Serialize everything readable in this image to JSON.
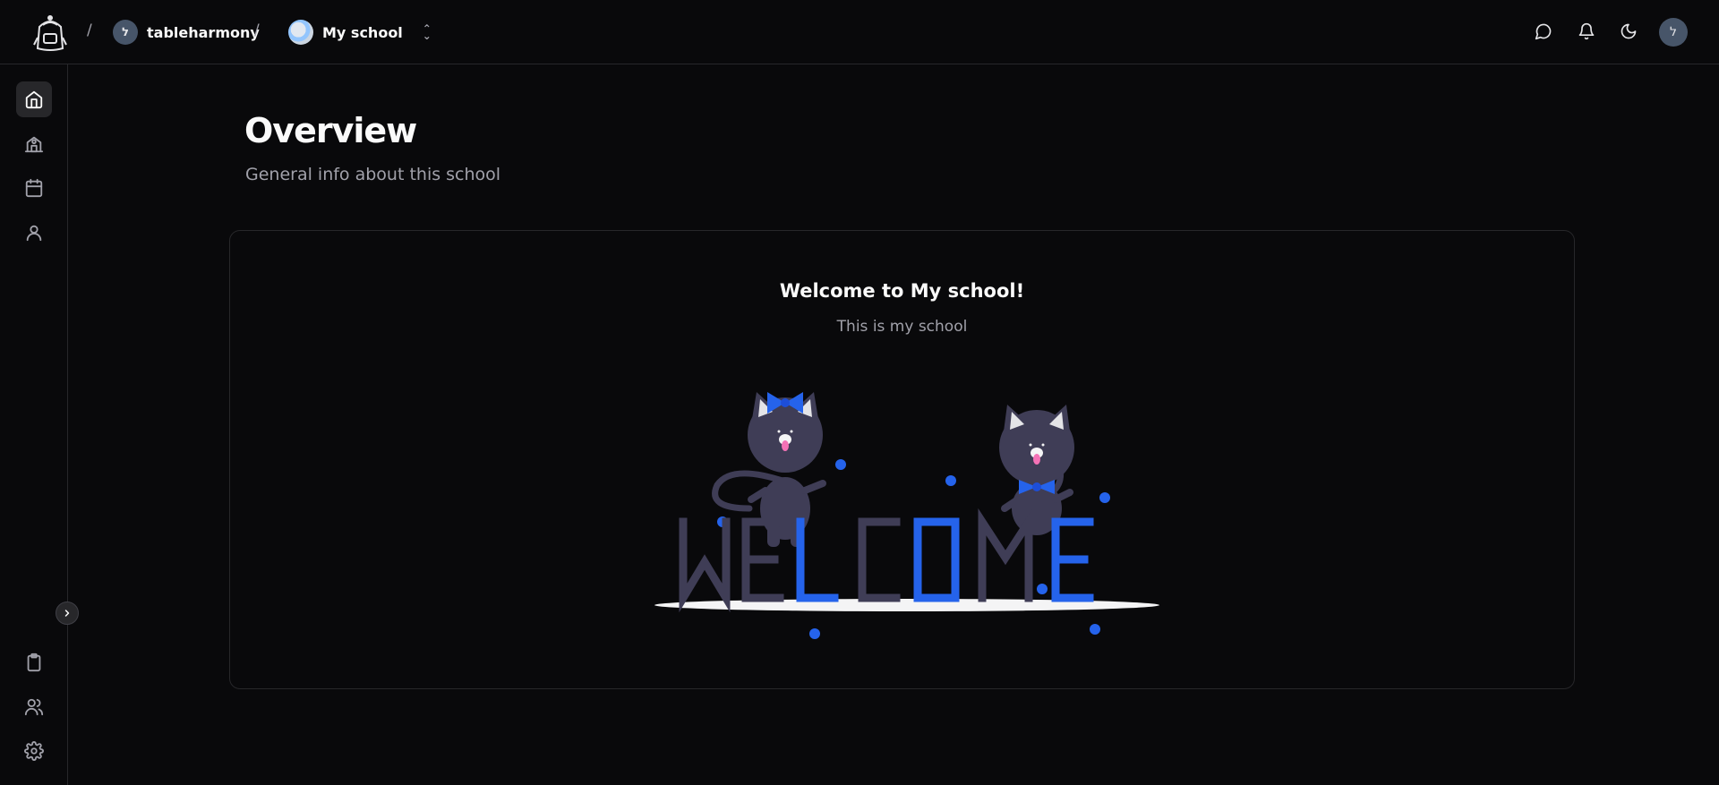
{
  "header": {
    "workspace_name": "tableharmony",
    "workspace_avatar_letter": "ל",
    "school_name": "My school",
    "user_avatar_letter": "ל",
    "icons": [
      "logo-icon",
      "message-icon",
      "bell-icon",
      "moon-icon"
    ]
  },
  "sidebar": {
    "top_items": [
      {
        "icon": "home-icon",
        "active": true
      },
      {
        "icon": "school-icon",
        "active": false
      },
      {
        "icon": "calendar-icon",
        "active": false
      },
      {
        "icon": "user-icon",
        "active": false
      }
    ],
    "bottom_items": [
      {
        "icon": "clipboard-icon"
      },
      {
        "icon": "users-icon"
      },
      {
        "icon": "settings-icon"
      }
    ],
    "expand_icon": "chevron-right-icon"
  },
  "main": {
    "title": "Overview",
    "subtitle": "General info about this school",
    "card": {
      "title": "Welcome to My school!",
      "subtitle": "This is my school",
      "illustration": {
        "letters": [
          "W",
          "E",
          "L",
          "C",
          "O",
          "M",
          "E"
        ],
        "accent_color": "#2563eb",
        "letter_color": "#3f3d56"
      }
    }
  },
  "colors": {
    "background": "#09090b",
    "border": "#27272a",
    "muted_text": "#a1a1aa",
    "accent": "#2563eb"
  }
}
